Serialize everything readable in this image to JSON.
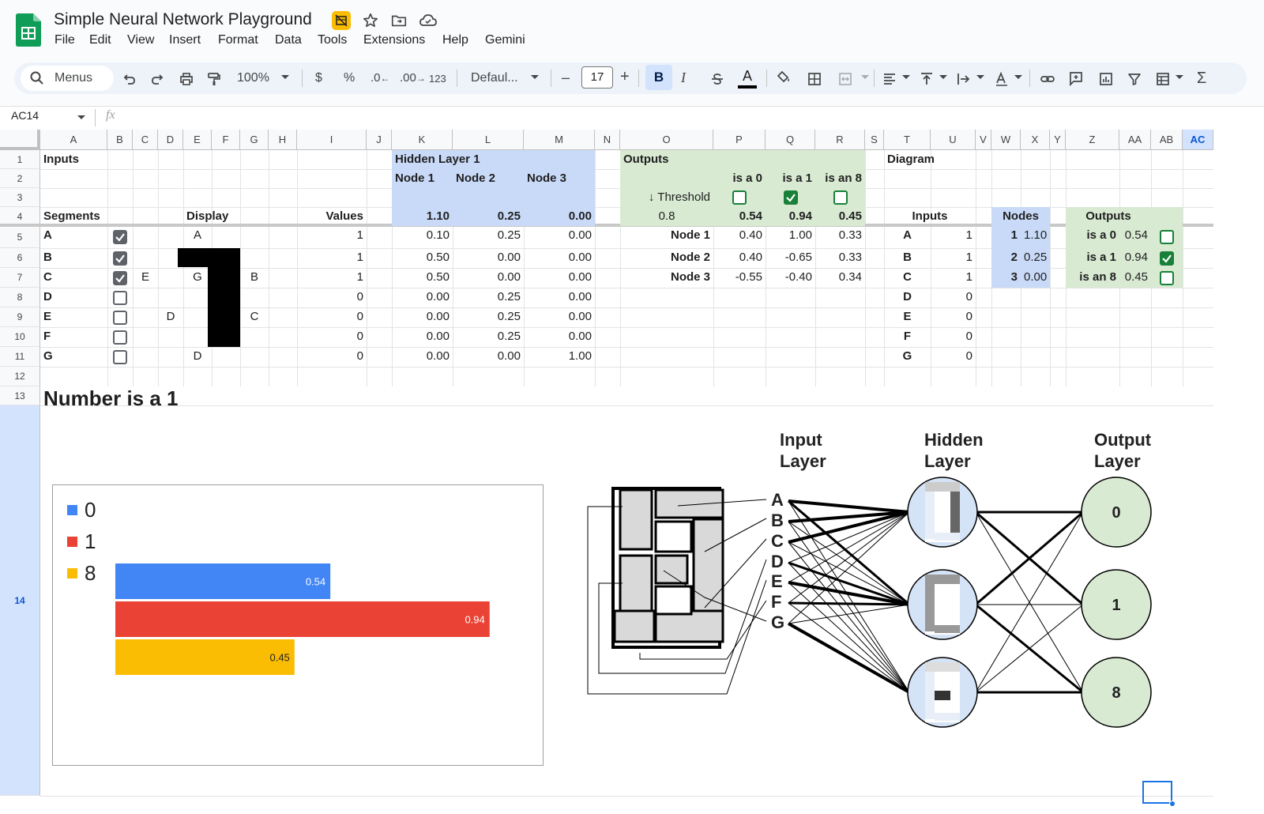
{
  "app": {
    "doc_title": "Simple Neural Network Playground",
    "menus": [
      "File",
      "Edit",
      "View",
      "Insert",
      "Format",
      "Data",
      "Tools",
      "Extensions",
      "Help",
      "Gemini"
    ]
  },
  "toolbar": {
    "search_label": "Menus",
    "zoom": "100%",
    "currency": "$",
    "percent": "%",
    "dec_less": ".0",
    "dec_more": ".00",
    "format_more": "123",
    "font": "Defaul...",
    "font_size": "17",
    "minus": "–",
    "plus": "+"
  },
  "formula_bar": {
    "cell_ref": "AC14",
    "fx": "fx",
    "value": ""
  },
  "columns": [
    "A",
    "B",
    "C",
    "D",
    "E",
    "F",
    "G",
    "H",
    "I",
    "J",
    "K",
    "L",
    "M",
    "N",
    "O",
    "P",
    "Q",
    "R",
    "S",
    "T",
    "U",
    "V",
    "W",
    "X",
    "Y",
    "Z",
    "AA",
    "AB",
    "AC"
  ],
  "rows": [
    "1",
    "2",
    "3",
    "4",
    "5",
    "6",
    "7",
    "8",
    "9",
    "10",
    "11",
    "12",
    "13",
    "14"
  ],
  "sheet": {
    "inputs_title": "Inputs",
    "segments_header": "Segments",
    "display_header": "Display",
    "values_header": "Values",
    "segments": [
      {
        "name": "A",
        "checked": true,
        "value": "1"
      },
      {
        "name": "B",
        "checked": true,
        "value": "1"
      },
      {
        "name": "C",
        "checked": true,
        "value": "1"
      },
      {
        "name": "D",
        "checked": false,
        "value": "0"
      },
      {
        "name": "E",
        "checked": false,
        "value": "0"
      },
      {
        "name": "F",
        "checked": false,
        "value": "0"
      },
      {
        "name": "G",
        "checked": false,
        "value": "0"
      }
    ],
    "display_labels": {
      "A": "A",
      "B": "B",
      "C": "C",
      "D": "D",
      "E": "E",
      "G": "G",
      "G2": "D"
    },
    "hidden": {
      "title": "Hidden Layer 1",
      "nodes": [
        "Node 1",
        "Node 2",
        "Node 3"
      ],
      "totals": [
        "1.10",
        "0.25",
        "0.00"
      ],
      "weights": [
        [
          "0.10",
          "0.25",
          "0.00"
        ],
        [
          "0.50",
          "0.00",
          "0.00"
        ],
        [
          "0.50",
          "0.00",
          "0.00"
        ],
        [
          "0.00",
          "0.25",
          "0.00"
        ],
        [
          "0.00",
          "0.25",
          "0.00"
        ],
        [
          "0.00",
          "0.25",
          "0.00"
        ],
        [
          "0.00",
          "0.00",
          "1.00"
        ]
      ]
    },
    "outputs": {
      "title": "Outputs",
      "labels": [
        "is a 0",
        "is a 1",
        "is an 8"
      ],
      "threshold_label": "↓ Threshold",
      "threshold_value": "0.8",
      "checks": [
        false,
        true,
        false
      ],
      "scores": [
        "0.54",
        "0.94",
        "0.45"
      ],
      "node_rows": [
        {
          "name": "Node 1",
          "w": [
            "0.40",
            "1.00",
            "0.33"
          ]
        },
        {
          "name": "Node 2",
          "w": [
            "0.40",
            "-0.65",
            "0.33"
          ]
        },
        {
          "name": "Node 3",
          "w": [
            "-0.55",
            "-0.40",
            "0.34"
          ]
        }
      ]
    },
    "diagram": {
      "title": "Diagram",
      "inputs_header": "Inputs",
      "nodes_header": "Nodes",
      "outputs_header": "Outputs",
      "inputs": [
        [
          "A",
          "1"
        ],
        [
          "B",
          "1"
        ],
        [
          "C",
          "1"
        ],
        [
          "D",
          "0"
        ],
        [
          "E",
          "0"
        ],
        [
          "F",
          "0"
        ],
        [
          "G",
          "0"
        ]
      ],
      "nodes": [
        [
          "1",
          "1.10"
        ],
        [
          "2",
          "0.25"
        ],
        [
          "3",
          "0.00"
        ]
      ],
      "outputs": [
        {
          "label": "is a 0",
          "value": "0.54",
          "checked": false
        },
        {
          "label": "is a 1",
          "value": "0.94",
          "checked": true
        },
        {
          "label": "is an 8",
          "value": "0.45",
          "checked": false
        }
      ]
    },
    "result_title": "Number is a 1"
  },
  "chart_data": {
    "type": "bar",
    "orientation": "horizontal",
    "categories": [
      "0",
      "1",
      "8"
    ],
    "values": [
      0.54,
      0.94,
      0.45
    ],
    "value_labels": [
      "0.54",
      "0.94",
      "0.45"
    ],
    "colors": [
      "#4285f4",
      "#ea4335",
      "#fbbc04"
    ],
    "xlim": [
      0,
      1
    ],
    "legend_position": "top-left",
    "grid": false
  },
  "network": {
    "input_layer_title": [
      "Input",
      "Layer"
    ],
    "hidden_layer_title": [
      "Hidden",
      "Layer"
    ],
    "output_layer_title": [
      "Output",
      "Layer"
    ],
    "input_letters": [
      "A",
      "B",
      "C",
      "D",
      "E",
      "F",
      "G"
    ],
    "output_labels": [
      "0",
      "1",
      "8"
    ]
  }
}
